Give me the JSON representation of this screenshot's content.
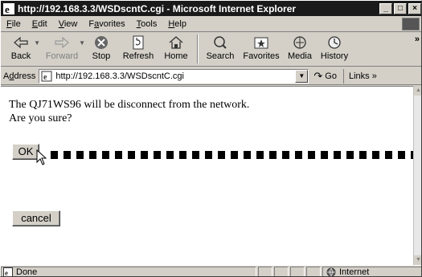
{
  "window": {
    "title": "http://192.168.3.3/WSDscntC.cgi - Microsoft Internet Explorer",
    "controls": {
      "minimize": "_",
      "maximize": "□",
      "close": "×"
    }
  },
  "menu": [
    {
      "label": "File",
      "key": "F",
      "rest": "ile"
    },
    {
      "label": "Edit",
      "key": "E",
      "rest": "dit"
    },
    {
      "label": "View",
      "key": "V",
      "rest": "iew"
    },
    {
      "label": "Favorites",
      "key": "a",
      "pre": "F",
      "rest": "vorites"
    },
    {
      "label": "Tools",
      "key": "T",
      "rest": "ools"
    },
    {
      "label": "Help",
      "key": "H",
      "rest": "elp"
    }
  ],
  "toolbar": {
    "back": "Back",
    "forward": "Forward",
    "stop": "Stop",
    "refresh": "Refresh",
    "home": "Home",
    "search": "Search",
    "favorites": "Favorites",
    "media": "Media",
    "history": "History",
    "more": "»"
  },
  "address": {
    "label_pre": "A",
    "label_key": "d",
    "label_rest": "dress",
    "url": "http://192.168.3.3/WSDscntC.cgi",
    "go": "Go",
    "links": "Links »"
  },
  "page": {
    "message_line1": "The QJ71WS96 will be disconnect from the network.",
    "message_line2": "Are you sure?",
    "ok_label": "OK",
    "cancel_label": "cancel"
  },
  "status": {
    "text": "Done",
    "zone": "Internet"
  }
}
